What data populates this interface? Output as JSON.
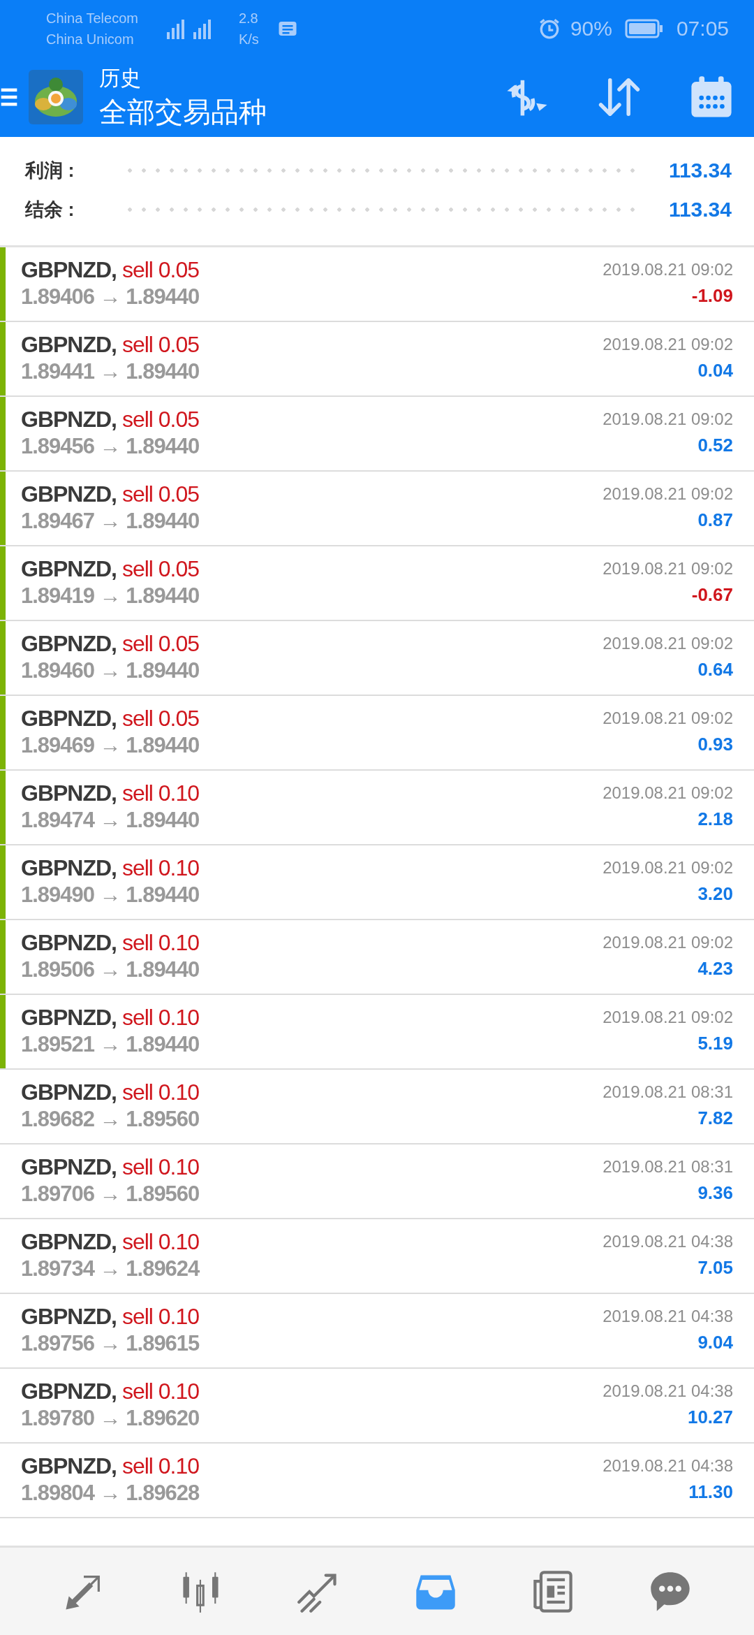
{
  "status_bar": {
    "carriers": [
      "China Telecom",
      "China Unicom"
    ],
    "speed": [
      "2.8",
      "K/s"
    ],
    "battery": "90%",
    "time": "07:05"
  },
  "header": {
    "title": "历史",
    "subtitle": "全部交易品种"
  },
  "summary": [
    {
      "label": "利润 :",
      "value": "113.34"
    },
    {
      "label": "结余 :",
      "value": "113.34"
    }
  ],
  "deals": [
    {
      "symbol": "GBPNZD,",
      "order": "sell 0.05",
      "prices": "1.89406 → 1.89440",
      "time": "2019.08.21 09:02",
      "profit": "-1.09",
      "loss": true,
      "highlighted": true
    },
    {
      "symbol": "GBPNZD,",
      "order": "sell 0.05",
      "prices": "1.89441 → 1.89440",
      "time": "2019.08.21 09:02",
      "profit": "0.04",
      "loss": false,
      "highlighted": true
    },
    {
      "symbol": "GBPNZD,",
      "order": "sell 0.05",
      "prices": "1.89456 → 1.89440",
      "time": "2019.08.21 09:02",
      "profit": "0.52",
      "loss": false,
      "highlighted": true
    },
    {
      "symbol": "GBPNZD,",
      "order": "sell 0.05",
      "prices": "1.89467 → 1.89440",
      "time": "2019.08.21 09:02",
      "profit": "0.87",
      "loss": false,
      "highlighted": true
    },
    {
      "symbol": "GBPNZD,",
      "order": "sell 0.05",
      "prices": "1.89419 → 1.89440",
      "time": "2019.08.21 09:02",
      "profit": "-0.67",
      "loss": true,
      "highlighted": true
    },
    {
      "symbol": "GBPNZD,",
      "order": "sell 0.05",
      "prices": "1.89460 → 1.89440",
      "time": "2019.08.21 09:02",
      "profit": "0.64",
      "loss": false,
      "highlighted": true
    },
    {
      "symbol": "GBPNZD,",
      "order": "sell 0.05",
      "prices": "1.89469 → 1.89440",
      "time": "2019.08.21 09:02",
      "profit": "0.93",
      "loss": false,
      "highlighted": true
    },
    {
      "symbol": "GBPNZD,",
      "order": "sell 0.10",
      "prices": "1.89474 → 1.89440",
      "time": "2019.08.21 09:02",
      "profit": "2.18",
      "loss": false,
      "highlighted": true
    },
    {
      "symbol": "GBPNZD,",
      "order": "sell 0.10",
      "prices": "1.89490 → 1.89440",
      "time": "2019.08.21 09:02",
      "profit": "3.20",
      "loss": false,
      "highlighted": true
    },
    {
      "symbol": "GBPNZD,",
      "order": "sell 0.10",
      "prices": "1.89506 → 1.89440",
      "time": "2019.08.21 09:02",
      "profit": "4.23",
      "loss": false,
      "highlighted": true
    },
    {
      "symbol": "GBPNZD,",
      "order": "sell 0.10",
      "prices": "1.89521 → 1.89440",
      "time": "2019.08.21 09:02",
      "profit": "5.19",
      "loss": false,
      "highlighted": true
    },
    {
      "symbol": "GBPNZD,",
      "order": "sell 0.10",
      "prices": "1.89682 → 1.89560",
      "time": "2019.08.21 08:31",
      "profit": "7.82",
      "loss": false,
      "highlighted": false
    },
    {
      "symbol": "GBPNZD,",
      "order": "sell 0.10",
      "prices": "1.89706 → 1.89560",
      "time": "2019.08.21 08:31",
      "profit": "9.36",
      "loss": false,
      "highlighted": false
    },
    {
      "symbol": "GBPNZD,",
      "order": "sell 0.10",
      "prices": "1.89734 → 1.89624",
      "time": "2019.08.21 04:38",
      "profit": "7.05",
      "loss": false,
      "highlighted": false
    },
    {
      "symbol": "GBPNZD,",
      "order": "sell 0.10",
      "prices": "1.89756 → 1.89615",
      "time": "2019.08.21 04:38",
      "profit": "9.04",
      "loss": false,
      "highlighted": false
    },
    {
      "symbol": "GBPNZD,",
      "order": "sell 0.10",
      "prices": "1.89780 → 1.89620",
      "time": "2019.08.21 04:38",
      "profit": "10.27",
      "loss": false,
      "highlighted": false
    },
    {
      "symbol": "GBPNZD,",
      "order": "sell 0.10",
      "prices": "1.89804 → 1.89628",
      "time": "2019.08.21 04:38",
      "profit": "11.30",
      "loss": false,
      "highlighted": false
    }
  ],
  "nav": [
    {
      "kind": "trade",
      "selected": false
    },
    {
      "kind": "chart",
      "selected": false
    },
    {
      "kind": "trend",
      "selected": false
    },
    {
      "kind": "history",
      "selected": true
    },
    {
      "kind": "news",
      "selected": false
    },
    {
      "kind": "chat",
      "selected": false
    }
  ]
}
